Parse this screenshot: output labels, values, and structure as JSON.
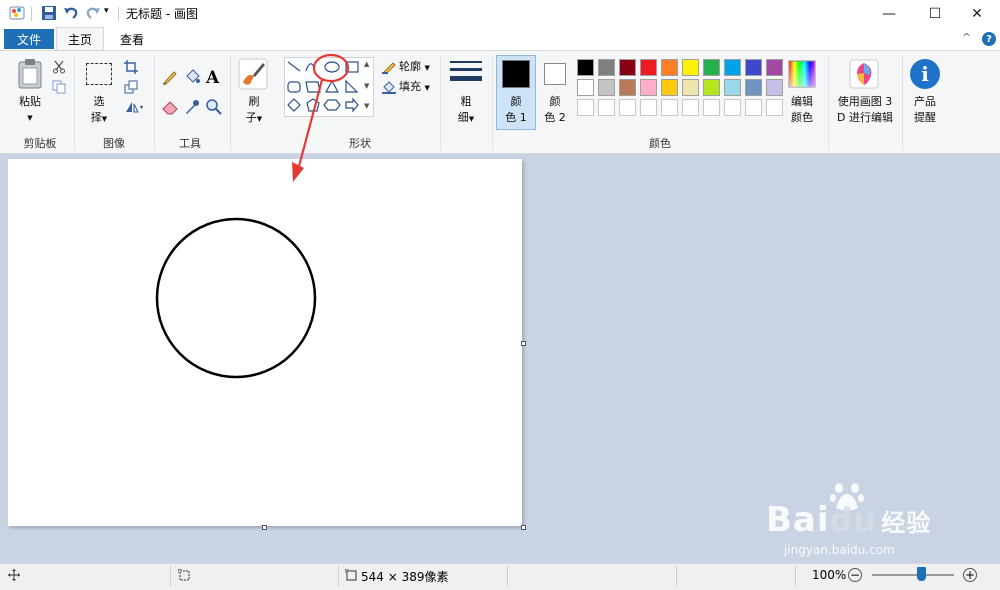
{
  "window": {
    "title": "无标题 - 画图",
    "controls": {
      "minimize": "—",
      "maximize": "☐",
      "close": "✕"
    }
  },
  "tabs": {
    "file": "文件",
    "home": "主页",
    "view": "查看"
  },
  "ribbon": {
    "help": "?",
    "collapse": "^",
    "clipboard": {
      "paste_line1": "粘贴",
      "group": "剪贴板"
    },
    "image": {
      "select_line1": "选",
      "select_line2": "择",
      "group": "图像"
    },
    "tools": {
      "group": "工具",
      "text_tool": "A"
    },
    "brushes": {
      "line1": "刷",
      "line2": "子"
    },
    "shapes": {
      "outline": "轮廓",
      "fill": "填充",
      "group": "形状"
    },
    "size": {
      "line1": "粗",
      "line2": "细"
    },
    "color1": {
      "line1": "颜",
      "line2": "色 1"
    },
    "color2": {
      "line1": "颜",
      "line2": "色 2"
    },
    "edit_colors": {
      "line1": "编辑",
      "line2": "颜色"
    },
    "paint3d": {
      "line1": "使用画图 3",
      "line2": "D 进行编辑"
    },
    "product_alert": {
      "line1": "产品",
      "line2": "提醒"
    },
    "colors_group": "颜色",
    "palette_row1": [
      "#000000",
      "#7f7f7f",
      "#880015",
      "#ed1c24",
      "#ff7f27",
      "#fff200",
      "#22b14c",
      "#00a2e8",
      "#3f48cc",
      "#a349a4"
    ],
    "palette_row2": [
      "#ffffff",
      "#c3c3c3",
      "#b97a57",
      "#ffaec9",
      "#ffc90e",
      "#efe4b0",
      "#b5e61d",
      "#99d9ea",
      "#7092be",
      "#c8bfe7"
    ],
    "color1_value": "#000000",
    "color2_value": "#ffffff"
  },
  "status": {
    "canvas_size": "544 × 389像素",
    "zoom": "100%",
    "zoom_slider_percent": 60
  },
  "watermark": {
    "line1": "Bai",
    "line2": "jingyan.baidu.com",
    "brand": "经验"
  },
  "accent": "#1e6fb5",
  "annotation_color": "#e53935"
}
